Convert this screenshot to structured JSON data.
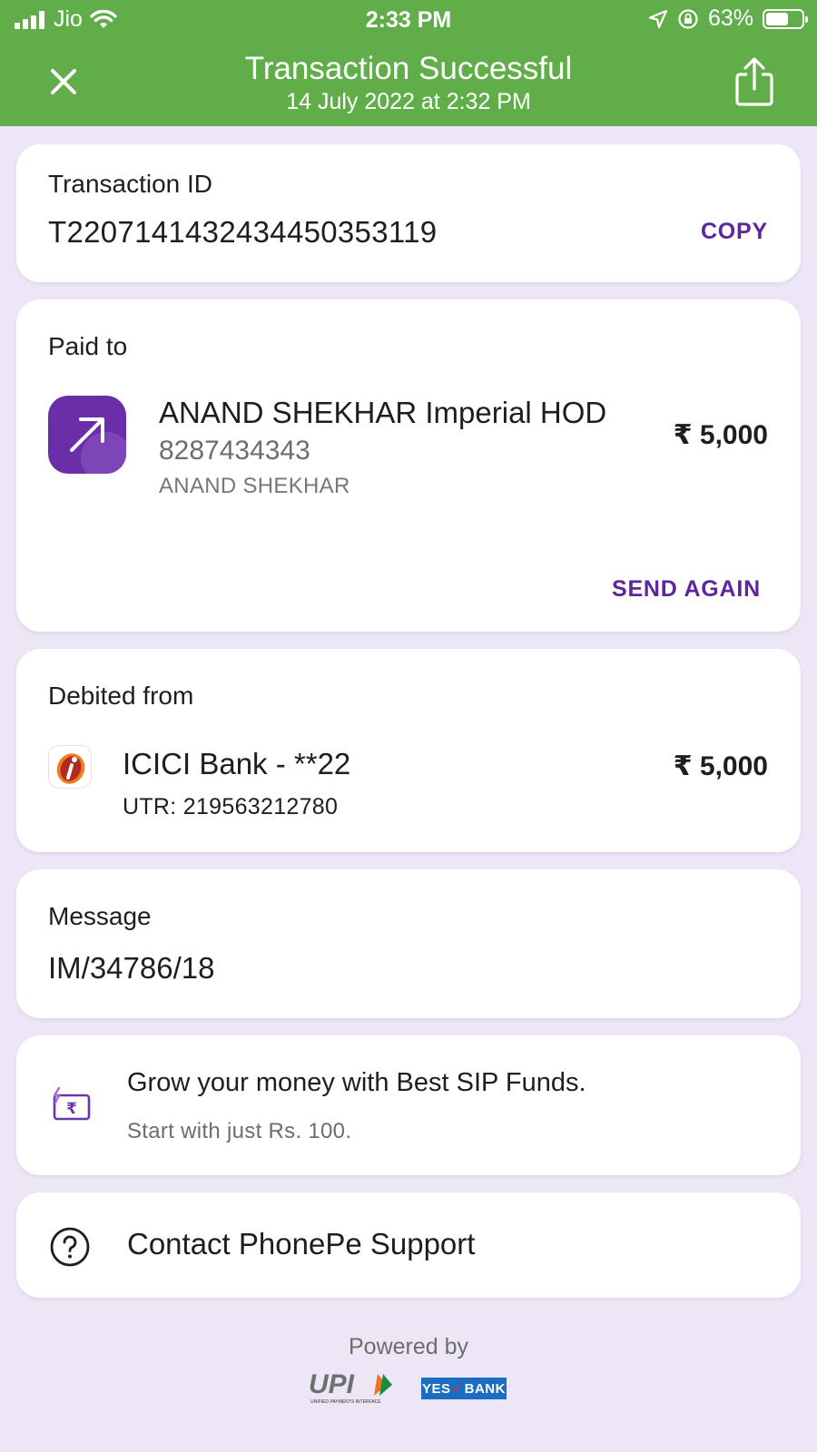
{
  "status_bar": {
    "carrier": "Jio",
    "time": "2:33 PM",
    "battery": "63%",
    "battery_level": 0.63
  },
  "header": {
    "title": "Transaction Successful",
    "subtitle": "14 July 2022 at 2:32 PM",
    "close_icon": "close-icon",
    "share_icon": "share-icon"
  },
  "transaction": {
    "label": "Transaction ID",
    "id": "T2207141432434450353119",
    "copy_label": "COPY"
  },
  "paid_to": {
    "label": "Paid to",
    "name": "ANAND SHEKHAR Imperial HOD",
    "phone": "8287434343",
    "sub_name": "ANAND SHEKHAR",
    "amount": "₹ 5,000",
    "send_again_label": "SEND AGAIN"
  },
  "debited_from": {
    "label": "Debited from",
    "bank": "ICICI Bank - **22",
    "utr": "UTR: 219563212780",
    "amount": "₹ 5,000"
  },
  "message": {
    "label": "Message",
    "text": "IM/34786/18"
  },
  "promo": {
    "title": "Grow your money with Best SIP Funds.",
    "subtitle": "Start with just Rs. 100."
  },
  "support": {
    "label": "Contact PhonePe Support"
  },
  "footer": {
    "powered_by": "Powered by",
    "upi_text": "UPI",
    "upi_sub": "UNIFIED PAYMENTS INTERFACE",
    "yes_text": "YES",
    "bank_text": "BANK"
  },
  "colors": {
    "header_green": "#60ad4a",
    "accent_purple": "#5f259f",
    "page_background": "#ece6f6"
  }
}
